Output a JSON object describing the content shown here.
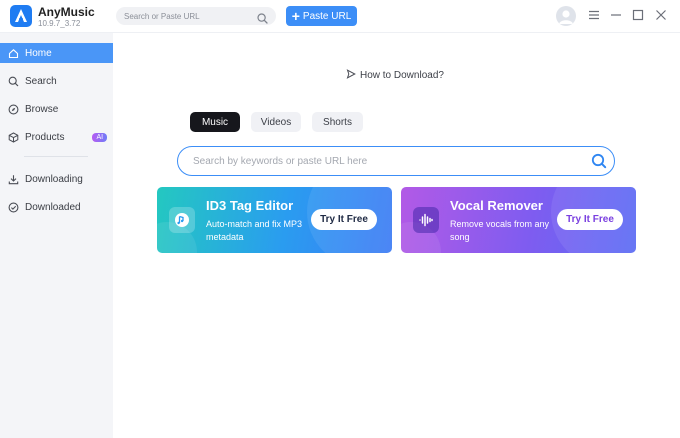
{
  "app": {
    "name": "AnyMusic",
    "version": "10.9.7_3.72"
  },
  "header": {
    "search_placeholder": "Search or Paste URL",
    "paste_button": "Paste URL"
  },
  "sidebar": {
    "items": [
      {
        "label": "Home",
        "icon": "home-icon",
        "active": true
      },
      {
        "label": "Search",
        "icon": "search-icon",
        "active": false
      },
      {
        "label": "Browse",
        "icon": "compass-icon",
        "active": false
      },
      {
        "label": "Products",
        "icon": "cube-icon",
        "active": false,
        "badge": "AI"
      },
      {
        "label": "Downloading",
        "icon": "download-icon",
        "active": false
      },
      {
        "label": "Downloaded",
        "icon": "check-circle-icon",
        "active": false
      }
    ]
  },
  "main": {
    "how_to_link": "How to Download?",
    "tabs": [
      {
        "label": "Music",
        "active": true
      },
      {
        "label": "Videos",
        "active": false
      },
      {
        "label": "Shorts",
        "active": false
      }
    ],
    "search_placeholder": "Search by keywords or paste URL here",
    "cards": [
      {
        "title": "ID3 Tag Editor",
        "description": "Auto-match and fix MP3 metadata",
        "button": "Try It Free"
      },
      {
        "title": "Vocal Remover",
        "description": "Remove vocals from any song",
        "button": "Try It Free"
      }
    ]
  },
  "colors": {
    "accent": "#3c8ef7",
    "active_tab": "#16171c",
    "sidebar_bg": "#f4f5f8"
  }
}
